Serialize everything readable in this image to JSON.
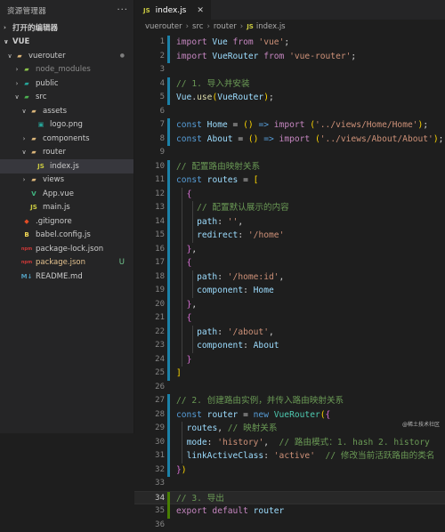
{
  "explorer": {
    "title": "资源管理器",
    "more": "···",
    "open_editors": "打开的编辑器",
    "workspace": "VUE",
    "tree": [
      {
        "label": "vuerouter",
        "depth": 0,
        "chev": "∨",
        "icon": "folder-icon",
        "status": "●"
      },
      {
        "label": "node_modules",
        "depth": 1,
        "chev": "›",
        "icon": "node-modules-folder-icon",
        "status": ""
      },
      {
        "label": "public",
        "depth": 1,
        "chev": "›",
        "icon": "folder-public-icon",
        "status": ""
      },
      {
        "label": "src",
        "depth": 1,
        "chev": "∨",
        "icon": "folder-src-icon",
        "status": ""
      },
      {
        "label": "assets",
        "depth": 2,
        "chev": "∨",
        "icon": "folder-icon",
        "status": ""
      },
      {
        "label": "logo.png",
        "depth": 3,
        "chev": "",
        "icon": "image-file-icon",
        "status": ""
      },
      {
        "label": "components",
        "depth": 2,
        "chev": "›",
        "icon": "folder-icon",
        "status": ""
      },
      {
        "label": "router",
        "depth": 2,
        "chev": "∨",
        "icon": "folder-icon",
        "status": ""
      },
      {
        "label": "index.js",
        "depth": 3,
        "chev": "",
        "icon": "js-file-icon",
        "status": ""
      },
      {
        "label": "views",
        "depth": 2,
        "chev": "›",
        "icon": "folder-icon",
        "status": ""
      },
      {
        "label": "App.vue",
        "depth": 2,
        "chev": "",
        "icon": "vue-file-icon",
        "status": ""
      },
      {
        "label": "main.js",
        "depth": 2,
        "chev": "",
        "icon": "js-file-icon",
        "status": ""
      },
      {
        "label": ".gitignore",
        "depth": 1,
        "chev": "",
        "icon": "git-file-icon",
        "status": ""
      },
      {
        "label": "babel.config.js",
        "depth": 1,
        "chev": "",
        "icon": "babel-file-icon",
        "status": ""
      },
      {
        "label": "package-lock.json",
        "depth": 1,
        "chev": "",
        "icon": "npm-file-icon",
        "status": ""
      },
      {
        "label": "package.json",
        "depth": 1,
        "chev": "",
        "icon": "npm-file-icon",
        "status": "U"
      },
      {
        "label": "README.md",
        "depth": 1,
        "chev": "",
        "icon": "markdown-file-icon",
        "status": ""
      }
    ]
  },
  "editor": {
    "tab": {
      "badge": "JS",
      "label": "index.js",
      "close": "✕"
    },
    "breadcrumb": [
      "vuerouter",
      "src",
      "router",
      "index.js"
    ],
    "breadcrumb_js_badge": "JS",
    "current_line": 34,
    "lines": [
      {
        "n": 1,
        "mark": "m",
        "tokens": [
          [
            "kw",
            "import"
          ],
          [
            "",
            ""
          ],
          [
            "va",
            " Vue"
          ],
          [
            "kw",
            " from"
          ],
          [
            "st",
            " 'vue'"
          ],
          [
            "",
            ";"
          ]
        ]
      },
      {
        "n": 2,
        "mark": "m",
        "tokens": [
          [
            "kw",
            "import"
          ],
          [
            "va",
            " VueRouter"
          ],
          [
            "kw",
            " from"
          ],
          [
            "st",
            " 'vue-router'"
          ],
          [
            "",
            ";"
          ]
        ]
      },
      {
        "n": 3,
        "mark": "",
        "tokens": []
      },
      {
        "n": 4,
        "mark": "m",
        "tokens": [
          [
            "cm",
            "// 1. 导入并安装"
          ]
        ]
      },
      {
        "n": 5,
        "mark": "m",
        "tokens": [
          [
            "va",
            "Vue"
          ],
          [
            "",
            "."
          ],
          [
            "fn",
            "use"
          ],
          [
            "br1",
            "("
          ],
          [
            "va",
            "VueRouter"
          ],
          [
            "br1",
            ")"
          ],
          [
            "",
            ";"
          ]
        ]
      },
      {
        "n": 6,
        "mark": "",
        "tokens": []
      },
      {
        "n": 7,
        "mark": "m",
        "tokens": [
          [
            "kb",
            "const"
          ],
          [
            "va",
            " Home"
          ],
          [
            "",
            " = "
          ],
          [
            "br1",
            "()"
          ],
          [
            "kb",
            " =>"
          ],
          [
            "kw",
            " import"
          ],
          [
            "br1",
            " ("
          ],
          [
            "st",
            "'../views/Home/Home'"
          ],
          [
            "br1",
            ")"
          ],
          [
            "",
            ";"
          ]
        ]
      },
      {
        "n": 8,
        "mark": "m",
        "tokens": [
          [
            "kb",
            "const"
          ],
          [
            "va",
            " About"
          ],
          [
            "",
            " = "
          ],
          [
            "br1",
            "()"
          ],
          [
            "kb",
            " =>"
          ],
          [
            "kw",
            " import"
          ],
          [
            "br1",
            " ("
          ],
          [
            "st",
            "'../views/About/About'"
          ],
          [
            "br1",
            ")"
          ],
          [
            "",
            ";"
          ]
        ]
      },
      {
        "n": 9,
        "mark": "",
        "tokens": []
      },
      {
        "n": 10,
        "mark": "m",
        "tokens": [
          [
            "cm",
            "// 配置路由映射关系"
          ]
        ]
      },
      {
        "n": 11,
        "mark": "m",
        "tokens": [
          [
            "kb",
            "const"
          ],
          [
            "va",
            " routes"
          ],
          [
            "",
            " = "
          ],
          [
            "br1",
            "["
          ]
        ]
      },
      {
        "n": 12,
        "mark": "m",
        "tokens": [
          [
            "",
            "  "
          ],
          [
            "br2",
            "{"
          ]
        ]
      },
      {
        "n": 13,
        "mark": "m",
        "tokens": [
          [
            "",
            "    "
          ],
          [
            "cm",
            "// 配置默认展示的内容"
          ]
        ]
      },
      {
        "n": 14,
        "mark": "m",
        "tokens": [
          [
            "",
            "    "
          ],
          [
            "va",
            "path"
          ],
          [
            "",
            ": "
          ],
          [
            "st",
            "''"
          ],
          [
            "",
            ","
          ]
        ]
      },
      {
        "n": 15,
        "mark": "m",
        "tokens": [
          [
            "",
            "    "
          ],
          [
            "va",
            "redirect"
          ],
          [
            "",
            ": "
          ],
          [
            "st",
            "'/home'"
          ]
        ]
      },
      {
        "n": 16,
        "mark": "m",
        "tokens": [
          [
            "",
            "  "
          ],
          [
            "br2",
            "}"
          ],
          [
            "",
            ","
          ]
        ]
      },
      {
        "n": 17,
        "mark": "m",
        "tokens": [
          [
            "",
            "  "
          ],
          [
            "br2",
            "{"
          ]
        ]
      },
      {
        "n": 18,
        "mark": "m",
        "tokens": [
          [
            "",
            "    "
          ],
          [
            "va",
            "path"
          ],
          [
            "",
            ": "
          ],
          [
            "st",
            "'/home:id'"
          ],
          [
            "",
            ","
          ]
        ]
      },
      {
        "n": 19,
        "mark": "m",
        "tokens": [
          [
            "",
            "    "
          ],
          [
            "va",
            "component"
          ],
          [
            "",
            ": "
          ],
          [
            "va",
            "Home"
          ]
        ]
      },
      {
        "n": 20,
        "mark": "m",
        "tokens": [
          [
            "",
            "  "
          ],
          [
            "br2",
            "}"
          ],
          [
            "",
            ","
          ]
        ]
      },
      {
        "n": 21,
        "mark": "m",
        "tokens": [
          [
            "",
            "  "
          ],
          [
            "br2",
            "{"
          ]
        ]
      },
      {
        "n": 22,
        "mark": "m",
        "tokens": [
          [
            "",
            "    "
          ],
          [
            "va",
            "path"
          ],
          [
            "",
            ": "
          ],
          [
            "st",
            "'/about'"
          ],
          [
            "",
            ","
          ]
        ]
      },
      {
        "n": 23,
        "mark": "m",
        "tokens": [
          [
            "",
            "    "
          ],
          [
            "va",
            "component"
          ],
          [
            "",
            ": "
          ],
          [
            "va",
            "About"
          ]
        ]
      },
      {
        "n": 24,
        "mark": "m",
        "tokens": [
          [
            "",
            "  "
          ],
          [
            "br2",
            "}"
          ]
        ]
      },
      {
        "n": 25,
        "mark": "m",
        "tokens": [
          [
            "br1",
            "]"
          ]
        ]
      },
      {
        "n": 26,
        "mark": "",
        "tokens": []
      },
      {
        "n": 27,
        "mark": "m",
        "tokens": [
          [
            "cm",
            "// 2. 创建路由实例，并传入路由映射关系"
          ]
        ]
      },
      {
        "n": 28,
        "mark": "m",
        "tokens": [
          [
            "kb",
            "const"
          ],
          [
            "va",
            " router"
          ],
          [
            "",
            " = "
          ],
          [
            "kb",
            "new"
          ],
          [
            "cl",
            " VueRouter"
          ],
          [
            "br1",
            "("
          ],
          [
            "br2",
            "{"
          ]
        ]
      },
      {
        "n": 29,
        "mark": "m",
        "tokens": [
          [
            "",
            "  "
          ],
          [
            "va",
            "routes"
          ],
          [
            "",
            ", "
          ],
          [
            "cm",
            "// 映射关系"
          ]
        ]
      },
      {
        "n": 30,
        "mark": "m",
        "tokens": [
          [
            "",
            "  "
          ],
          [
            "va",
            "mode"
          ],
          [
            "",
            ": "
          ],
          [
            "st",
            "'history'"
          ],
          [
            "",
            ",  "
          ],
          [
            "cm",
            "// 路由模式：1. hash 2. history"
          ]
        ]
      },
      {
        "n": 31,
        "mark": "m",
        "tokens": [
          [
            "",
            "  "
          ],
          [
            "va",
            "linkActiveClass"
          ],
          [
            "",
            ": "
          ],
          [
            "st",
            "'active'"
          ],
          [
            "",
            "  "
          ],
          [
            "cm",
            "// 修改当前活跃路由的类名"
          ]
        ]
      },
      {
        "n": 32,
        "mark": "m",
        "tokens": [
          [
            "br2",
            "}"
          ],
          [
            "br1",
            ")"
          ]
        ]
      },
      {
        "n": 33,
        "mark": "",
        "tokens": []
      },
      {
        "n": 34,
        "mark": "a",
        "tokens": [
          [
            "cm",
            "// 3. 导出"
          ]
        ]
      },
      {
        "n": 35,
        "mark": "a",
        "tokens": [
          [
            "kw",
            "export"
          ],
          [
            "kw",
            " default"
          ],
          [
            "va",
            " router"
          ]
        ]
      },
      {
        "n": 36,
        "mark": "",
        "tokens": []
      }
    ]
  },
  "watermark": "@稀土技术社区",
  "colors": {
    "sidebar_bg": "#252526",
    "editor_bg": "#1e1e1e",
    "modified": "#1b81a8",
    "added": "#487e02"
  }
}
